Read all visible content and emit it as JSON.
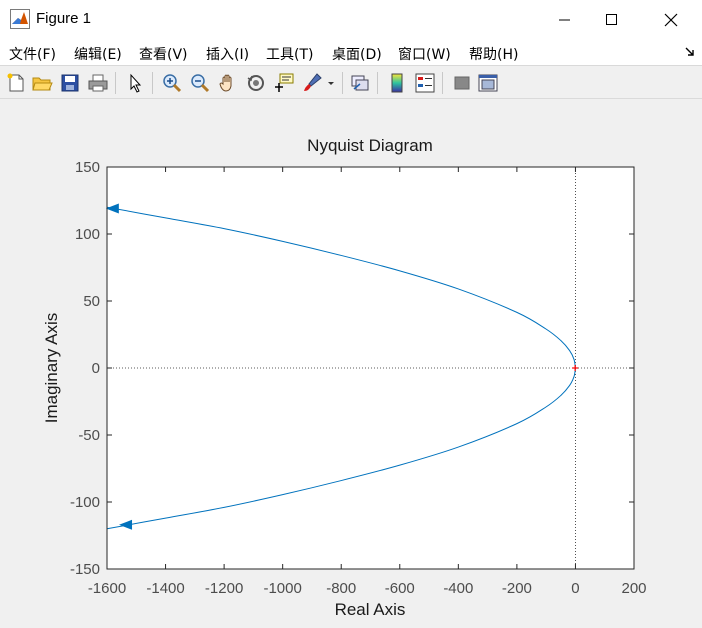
{
  "window": {
    "title": "Figure 1",
    "icon": "matlab-icon"
  },
  "menu": {
    "items": [
      "文件(F)",
      "编辑(E)",
      "查看(V)",
      "插入(I)",
      "工具(T)",
      "桌面(D)",
      "窗口(W)",
      "帮助(H)"
    ]
  },
  "toolbar": {
    "icons": [
      "new-figure-icon",
      "open-file-icon",
      "save-icon",
      "print-icon",
      "pointer-icon",
      "zoom-in-icon",
      "zoom-out-icon",
      "pan-hand-icon",
      "rotate-3d-icon",
      "data-cursor-icon",
      "brush-icon",
      "brush-dropdown-icon",
      "link-plot-icon",
      "insert-colorbar-icon",
      "insert-legend-icon",
      "hide-plot-tools-icon",
      "show-plot-tools-icon"
    ]
  },
  "colors": {
    "curve": "#0072bd",
    "axes": "#262626",
    "critical_point": "#ff0000"
  },
  "chart_data": {
    "type": "line",
    "title": "Nyquist Diagram",
    "xlabel": "Real Axis",
    "ylabel": "Imaginary Axis",
    "xlim": [
      -1600,
      200
    ],
    "ylim": [
      -150,
      150
    ],
    "xticks": [
      "-1600",
      "-1400",
      "-1200",
      "-1000",
      "-800",
      "-600",
      "-400",
      "-200",
      "0",
      "200"
    ],
    "yticks": [
      "150",
      "100",
      "50",
      "0",
      "-50",
      "-100",
      "-150"
    ],
    "xtick_values": [
      -1600,
      -1400,
      -1200,
      -1000,
      -800,
      -600,
      -400,
      -200,
      0,
      200
    ],
    "ytick_values": [
      150,
      100,
      50,
      0,
      -50,
      -100,
      -150
    ],
    "grid": false,
    "reference_lines": {
      "x": 0,
      "y": 0,
      "style": "dotted"
    },
    "critical_point": {
      "x": -1,
      "y": 0
    },
    "series": [
      {
        "x": [
          -1600,
          -1400,
          -1200,
          -1000,
          -800,
          -600,
          -400,
          -200,
          -100,
          -50,
          -20,
          -5,
          0
        ],
        "y": [
          120,
          112,
          104,
          94.5,
          84,
          72.5,
          59,
          41.5,
          29,
          20.5,
          13,
          6.5,
          0
        ]
      },
      {
        "x": [
          0,
          -5,
          -20,
          -50,
          -100,
          -200,
          -400,
          -600,
          -800,
          -1000,
          -1200,
          -1400,
          -1600
        ],
        "y": [
          0,
          -6.5,
          -13,
          -20.5,
          -29,
          -41.5,
          -59,
          -72.5,
          -84,
          -94.5,
          -104,
          -112,
          -120
        ]
      }
    ],
    "arrows": [
      {
        "x": -1580,
        "y": 119,
        "direction": "left"
      },
      {
        "x": -1535,
        "y": -117,
        "direction": "left"
      }
    ]
  }
}
